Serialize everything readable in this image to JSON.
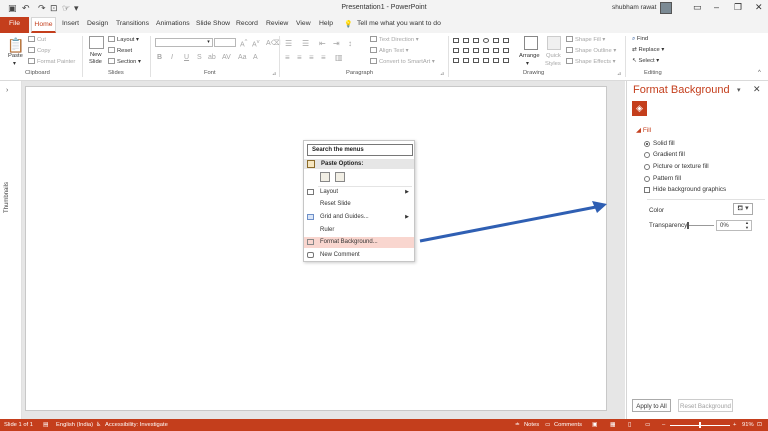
{
  "window": {
    "title": "Presentation1  -  PowerPoint",
    "user": "shubham rawat"
  },
  "tabs": [
    "File",
    "Home",
    "Insert",
    "Design",
    "Transitions",
    "Animations",
    "Slide Show",
    "Record",
    "Review",
    "View",
    "Help"
  ],
  "tell_me": "Tell me what you want to do",
  "ribbon": {
    "clipboard": {
      "label": "Clipboard",
      "paste": "Paste",
      "cut": "Cut",
      "copy": "Copy",
      "format_painter": "Format Painter"
    },
    "slides": {
      "label": "Slides",
      "new_slide": "New",
      "new_slide2": "Slide",
      "layout": "Layout",
      "reset": "Reset",
      "section": "Section"
    },
    "font": {
      "label": "Font",
      "bold": "B",
      "italic": "I",
      "underline": "U",
      "strike": "S",
      "shadow": "ab"
    },
    "paragraph": {
      "label": "Paragraph",
      "text_direction": "Text Direction",
      "align_text": "Align Text",
      "smartart": "Convert to SmartArt"
    },
    "drawing": {
      "label": "Drawing",
      "arrange": "Arrange",
      "quick_styles": "Quick",
      "quick_styles2": "Styles",
      "shape_fill": "Shape Fill",
      "shape_outline": "Shape Outline",
      "shape_effects": "Shape Effects"
    },
    "editing": {
      "label": "Editing",
      "find": "Find",
      "replace": "Replace",
      "select": "Select"
    }
  },
  "thumbnails_label": "Thumbnails",
  "context_menu": {
    "search_placeholder": "Search the menus",
    "paste_options": "Paste Options:",
    "items": [
      "Layout",
      "Reset Slide",
      "Grid and Guides...",
      "Ruler",
      "Format Background...",
      "New Comment"
    ]
  },
  "format_pane": {
    "title": "Format Background",
    "fill_section": "Fill",
    "options": [
      "Solid fill",
      "Gradient fill",
      "Picture or texture fill",
      "Pattern fill"
    ],
    "selected_option": "Solid fill",
    "hide_graphics": "Hide background graphics",
    "color_label": "Color",
    "transparency_label": "Transparency",
    "transparency_value": "0%",
    "apply_all": "Apply to All",
    "reset": "Reset Background"
  },
  "status": {
    "slide": "Slide 1 of 1",
    "language": "English (India)",
    "accessibility": "Accessibility: Investigate",
    "notes": "Notes",
    "comments": "Comments",
    "zoom": "91%"
  },
  "colors": {
    "accent": "#c43e1c",
    "highlight": "#f9d6cf",
    "arrow": "#2f5fb3"
  }
}
